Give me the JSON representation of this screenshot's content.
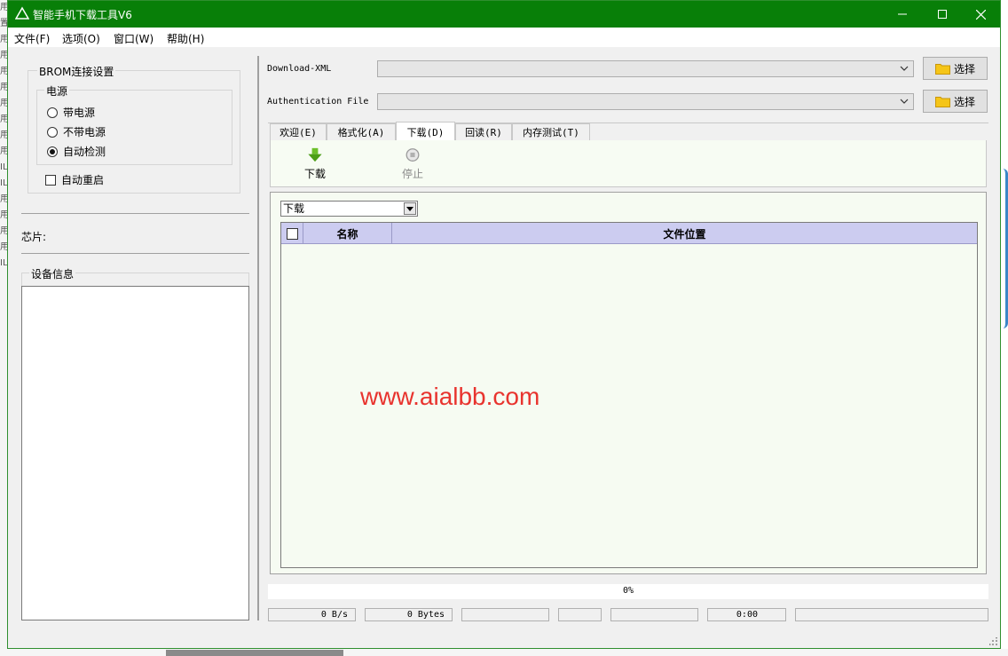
{
  "window": {
    "title": "智能手机下载工具V6",
    "accent_color": "#087f08"
  },
  "titlebar_buttons": {
    "minimize": "minimize-icon",
    "maximize": "maximize-icon",
    "close": "close-icon"
  },
  "menu": {
    "file": "文件(F)",
    "options": "选项(O)",
    "window": "窗口(W)",
    "help": "帮助(H)"
  },
  "brom": {
    "group_title": "BROM连接设置",
    "power_title": "电源",
    "options": [
      "带电源",
      "不带电源",
      "自动检测"
    ],
    "selected": "自动检测",
    "auto_reboot_label": "自动重启",
    "auto_reboot_checked": false
  },
  "chip": {
    "label": "芯片:"
  },
  "device_info": {
    "title": "设备信息"
  },
  "files": {
    "download_xml_label": "Download-XML",
    "download_xml_value": "",
    "auth_file_label": "Authentication File",
    "auth_file_value": "",
    "choose_label": "选择"
  },
  "tabs": [
    {
      "label": "欢迎(E)"
    },
    {
      "label": "格式化(A)"
    },
    {
      "label": "下载(D)"
    },
    {
      "label": "回读(R)"
    },
    {
      "label": "内存测试(T)"
    }
  ],
  "active_tab": "下载(D)",
  "toolbar": {
    "download_label": "下载",
    "stop_label": "停止"
  },
  "download_panel": {
    "mode_value": "下载",
    "columns": [
      "名称",
      "文件位置"
    ],
    "rows": []
  },
  "watermark": "www.aialbb.com",
  "progress": {
    "text": "0%",
    "value": 0
  },
  "status": {
    "speed": "0 B/s",
    "bytes": "0 Bytes",
    "field3": "",
    "field4": "",
    "field5": "",
    "time": "0:00",
    "field7": ""
  }
}
